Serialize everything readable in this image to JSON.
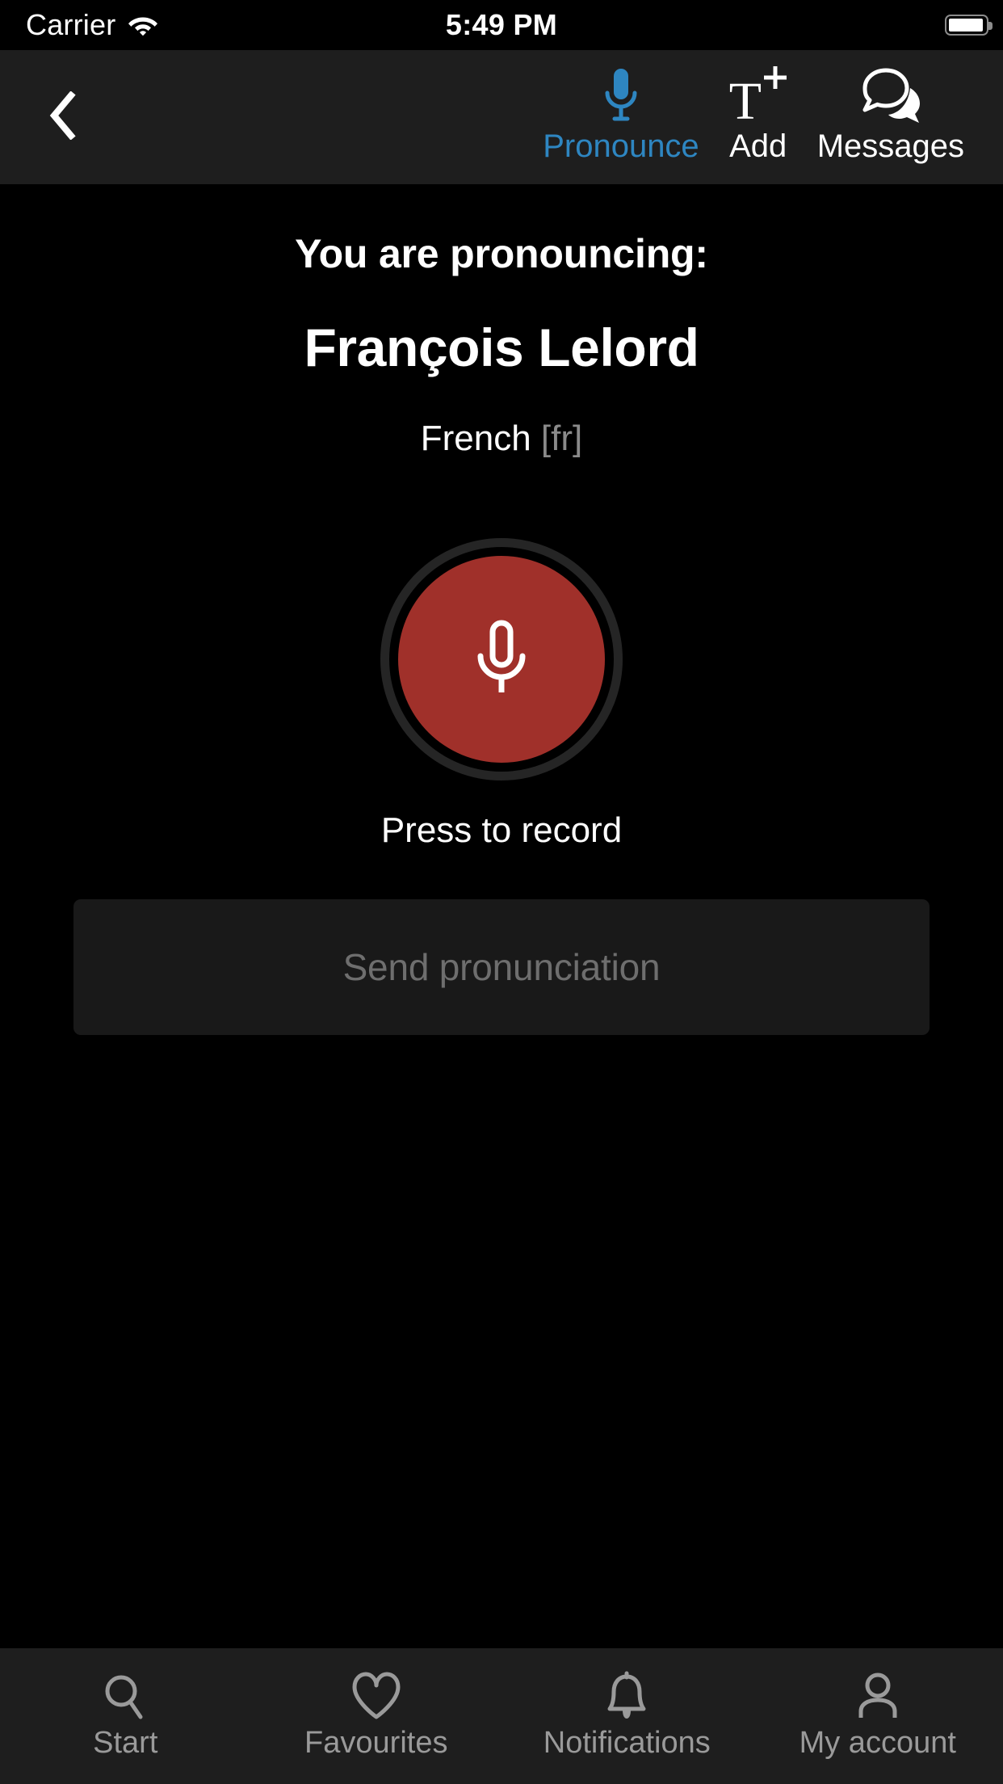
{
  "status_bar": {
    "carrier": "Carrier",
    "wifi_icon": "wifi-icon",
    "time": "5:49 PM",
    "battery_icon": "battery-icon",
    "battery_level": 90
  },
  "nav_bar": {
    "back_icon": "chevron-left-icon",
    "actions": [
      {
        "id": "pronounce",
        "label": "Pronounce",
        "icon": "microphone-icon",
        "active": true,
        "color": "#2e86c1"
      },
      {
        "id": "add",
        "label": "Add",
        "icon": "text-plus-icon",
        "active": false,
        "color": "#ffffff"
      },
      {
        "id": "messages",
        "label": "Messages",
        "icon": "speech-bubbles-icon",
        "active": false,
        "color": "#ffffff"
      }
    ]
  },
  "main": {
    "heading": "You are pronouncing:",
    "name": "François Lelord",
    "language": "French",
    "language_code": "[fr]",
    "record_button": {
      "icon": "microphone-icon",
      "fill_color": "#a0302a",
      "ring_color": "#252525"
    },
    "press_label": "Press to record",
    "send_button": {
      "label": "Send pronunciation",
      "disabled": true,
      "text_color": "#6e6e6e",
      "background": "#191919"
    }
  },
  "tab_bar": {
    "items": [
      {
        "id": "start",
        "label": "Start",
        "icon": "search-icon"
      },
      {
        "id": "favourites",
        "label": "Favourites",
        "icon": "heart-icon"
      },
      {
        "id": "notifications",
        "label": "Notifications",
        "icon": "bell-icon"
      },
      {
        "id": "my-account",
        "label": "My account",
        "icon": "person-icon"
      }
    ],
    "inactive_color": "#9a9a9a"
  }
}
